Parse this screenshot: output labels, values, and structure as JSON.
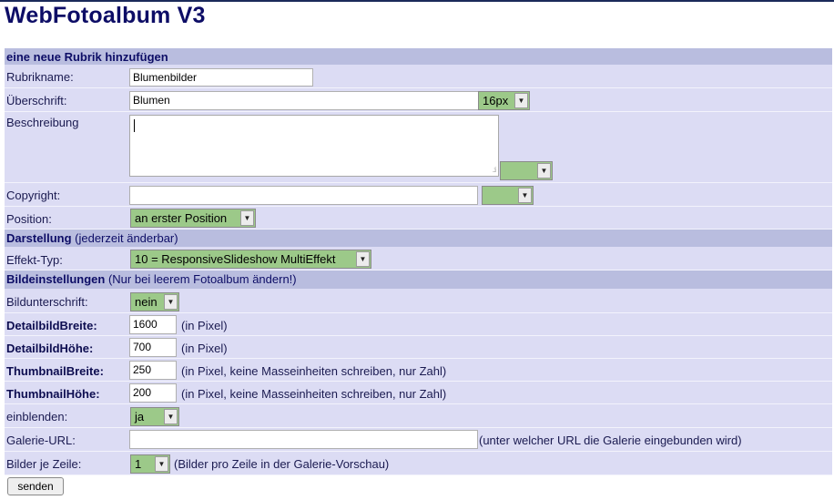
{
  "app_title": "WebFotoalbum V3",
  "sections": {
    "new_category": "eine neue Rubrik hinzufügen",
    "display": "Darstellung",
    "display_note": "(jederzeit änderbar)",
    "image_settings": "Bildeinstellungen",
    "image_settings_note": "(Nur bei leerem Fotoalbum ändern!)"
  },
  "fields": {
    "rubrikname": {
      "label": "Rubrikname:",
      "value": "Blumenbilder"
    },
    "ueberschrift": {
      "label": "Überschrift:",
      "value": "Blumen",
      "size_select": "16px"
    },
    "beschreibung": {
      "label": "Beschreibung",
      "value": "",
      "size_select": ""
    },
    "copyright": {
      "label": "Copyright:",
      "value": "",
      "size_select": ""
    },
    "position": {
      "label": "Position:",
      "select": "an erster Position"
    },
    "effekt_typ": {
      "label": "Effekt-Typ:",
      "select": "10 = ResponsiveSlideshow MultiEffekt"
    },
    "bildunterschrift": {
      "label": "Bildunterschrift:",
      "select": "nein"
    },
    "detailbild_breite": {
      "label": "DetailbildBreite:",
      "value": "1600",
      "note": "(in Pixel)"
    },
    "detailbild_hoehe": {
      "label": "DetailbildHöhe:",
      "value": "700",
      "note": "(in Pixel)"
    },
    "thumbnail_breite": {
      "label": "ThumbnailBreite:",
      "value": "250",
      "note": "(in Pixel, keine Masseinheiten schreiben, nur Zahl)"
    },
    "thumbnail_hoehe": {
      "label": "ThumbnailHöhe:",
      "value": "200",
      "note": "(in Pixel, keine Masseinheiten schreiben, nur Zahl)"
    },
    "einblenden": {
      "label": "einblenden:",
      "select": "ja"
    },
    "galerie_url": {
      "label": "Galerie-URL:",
      "value": "",
      "note": "(unter welcher URL die Galerie eingebunden wird)"
    },
    "bilder_je_zeile": {
      "label": "Bilder je Zeile:",
      "select": "1",
      "note": "(Bilder pro Zeile in der Galerie-Vorschau)"
    }
  },
  "submit_label": "senden",
  "icons": {
    "dropdown": "chevron-down-icon",
    "resize": "resize-grip-icon"
  },
  "colors": {
    "header_row": "#b9bddf",
    "normal_row": "#dcdcf4",
    "select_bg": "#9cc989",
    "title": "#0d0d66"
  }
}
